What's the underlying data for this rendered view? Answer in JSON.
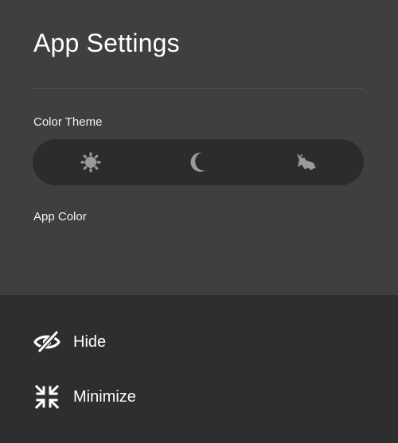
{
  "settings": {
    "title": "App Settings",
    "color_theme_label": "Color Theme",
    "theme_options": [
      {
        "icon": "sun-icon"
      },
      {
        "icon": "moon-icon"
      },
      {
        "icon": "bat-icon"
      }
    ],
    "app_color_label": "App Color"
  },
  "actions": {
    "hide_label": "Hide",
    "minimize_label": "Minimize"
  },
  "colors": {
    "settings_bg": "#3f3f41",
    "actions_bg": "#2e2e30",
    "switch_bg": "#2c2c2e",
    "icon_gray": "#9a9a9c",
    "text": "#ffffff"
  }
}
